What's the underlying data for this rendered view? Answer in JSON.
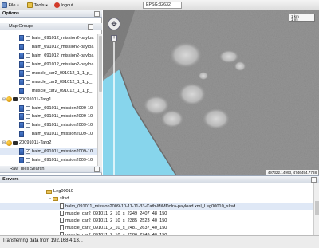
{
  "toolbar": {
    "file_label": "File",
    "tools_label": "Tools",
    "logout_label": "logout",
    "projection": "EPSG:32632"
  },
  "options": {
    "title": "Options",
    "map_groups_label": "Map Groups",
    "raw_tiles_label": "Raw Tiles Search",
    "tree": [
      {
        "kind": "layer",
        "text": "balm_091012_mission2-payloa",
        "checked": false
      },
      {
        "kind": "layer",
        "text": "balm_091012_mission2-payloa",
        "checked": false
      },
      {
        "kind": "layer",
        "text": "balm_091012_mission2-payloa",
        "checked": false
      },
      {
        "kind": "layer",
        "text": "balm_091012_mission2-payloa",
        "checked": false
      },
      {
        "kind": "layer",
        "text": "muscle_car2_091012_1_1_p_",
        "checked": false
      },
      {
        "kind": "layer",
        "text": "muscle_car2_091012_1_1_p_",
        "checked": false
      },
      {
        "kind": "layer",
        "text": "muscle_car2_091012_1_1_p_",
        "checked": false
      },
      {
        "kind": "group",
        "text": "20091011-Targ1"
      },
      {
        "kind": "layer",
        "text": "balm_091011_mission2009-10",
        "checked": false
      },
      {
        "kind": "layer",
        "text": "balm_091011_mission2009-10",
        "checked": false
      },
      {
        "kind": "layer",
        "text": "balm_091011_mission2009-10",
        "checked": false
      },
      {
        "kind": "layer",
        "text": "balm_091011_mission2009-10",
        "checked": false
      },
      {
        "kind": "group",
        "text": "20091011-Targ2"
      },
      {
        "kind": "layer",
        "text": "balm_091011_mission2009-10",
        "checked": true,
        "selected": true
      },
      {
        "kind": "layer",
        "text": "balm_091011_mission2009-10",
        "checked": false
      },
      {
        "kind": "layer",
        "text": "balm_091011_mission2009-10",
        "checked": false
      }
    ]
  },
  "map": {
    "scale_top": "1 km",
    "scale_bottom": "1 mi",
    "coordinates": "497322.14993, 4746494.7788",
    "colors": {
      "water": "#87d5ec",
      "sar": "#8a8a8a"
    }
  },
  "servers": {
    "title": "Servers",
    "rows": [
      {
        "kind": "folder",
        "text": "Leg00010",
        "expander": "−"
      },
      {
        "kind": "folder",
        "text": "sltsd",
        "expander": "−"
      },
      {
        "kind": "file",
        "text": "balm_091011_mission2009-10-11-11-33-Cath-MiMDolra-payload.xml_Leg00010_sltsd",
        "selected": true
      },
      {
        "kind": "file",
        "text": "muscle_car2_091011_2_10_s_2249_2407_48_150"
      },
      {
        "kind": "file",
        "text": "muscle_car2_091011_2_10_s_2385_2523_40_150"
      },
      {
        "kind": "file",
        "text": "muscle_car2_091011_2_10_s_2481_2637_40_150"
      },
      {
        "kind": "file",
        "text": "muscle_car2_091011_2_10_s_2586_2749_40_150"
      }
    ]
  },
  "status": {
    "text": "Transferring data from 192.168.4.13..."
  }
}
